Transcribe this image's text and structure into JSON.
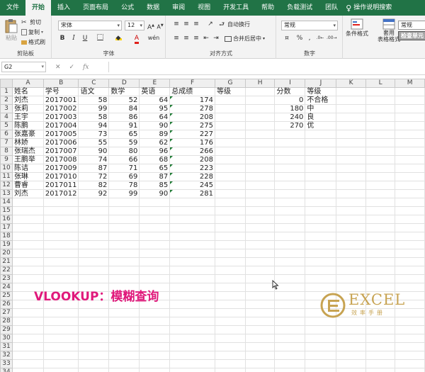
{
  "menu": {
    "tabs": [
      "文件",
      "开始",
      "插入",
      "页面布局",
      "公式",
      "数据",
      "审阅",
      "视图",
      "开发工具",
      "帮助",
      "负载测试",
      "团队"
    ],
    "active_tab": "开始",
    "tell_me": "操作说明搜索"
  },
  "ribbon": {
    "clipboard": {
      "paste": "粘贴",
      "cut": "剪切",
      "copy": "复制",
      "format_painter": "格式刷",
      "label": "剪贴板"
    },
    "font": {
      "name": "宋体",
      "size": "12",
      "bold": "B",
      "italic": "I",
      "underline": "U",
      "grow": "A",
      "shrink": "A",
      "label": "字体",
      "wen": "wén"
    },
    "alignment": {
      "wrap": "自动换行",
      "merge": "合并后居中",
      "label": "对齐方式"
    },
    "number": {
      "format": "常规",
      "percent": "%",
      "comma": ",",
      "label": "数字"
    },
    "styles": {
      "conditional": "条件格式",
      "table_format_1": "套用",
      "table_format_2": "表格格式",
      "style_1": "常规",
      "style_2": "检查单元"
    }
  },
  "formula_bar": {
    "name_box": "G2",
    "cancel": "✕",
    "enter": "✓",
    "fx": "fx",
    "value": ""
  },
  "sheet": {
    "columns": [
      "A",
      "B",
      "C",
      "D",
      "E",
      "F",
      "G",
      "H",
      "I",
      "J",
      "K",
      "L",
      "M"
    ],
    "row_numbers": [
      "1",
      "2",
      "3",
      "4",
      "5",
      "6",
      "7",
      "8",
      "9",
      "10",
      "11",
      "12",
      "13",
      "14",
      "15",
      "16",
      "17",
      "18",
      "19",
      "20",
      "21",
      "22",
      "23",
      "24",
      "25",
      "26",
      "27",
      "28",
      "29",
      "30",
      "31",
      "32",
      "33",
      "34"
    ],
    "headers": [
      "姓名",
      "学号",
      "语文",
      "数学",
      "英语",
      "总成绩",
      "等级"
    ],
    "rows": [
      [
        "刘杰",
        "2017001",
        "58",
        "52",
        "64",
        "174"
      ],
      [
        "张莉",
        "2017002",
        "99",
        "84",
        "95",
        "278"
      ],
      [
        "王宇",
        "2017003",
        "58",
        "86",
        "64",
        "208"
      ],
      [
        "陈鹏",
        "2017004",
        "94",
        "91",
        "90",
        "275"
      ],
      [
        "张嘉豪",
        "2017005",
        "73",
        "65",
        "89",
        "227"
      ],
      [
        "林娇",
        "2017006",
        "55",
        "59",
        "62",
        "176"
      ],
      [
        "张瑞杰",
        "2017007",
        "90",
        "80",
        "96",
        "266"
      ],
      [
        "王鹏举",
        "2017008",
        "74",
        "66",
        "68",
        "208"
      ],
      [
        "陈诘",
        "2017009",
        "87",
        "71",
        "65",
        "223"
      ],
      [
        "张琳",
        "2017010",
        "72",
        "69",
        "87",
        "228"
      ],
      [
        "曹睿",
        "2017011",
        "82",
        "78",
        "85",
        "245"
      ],
      [
        "刘杰",
        "2017012",
        "92",
        "99",
        "90",
        "281"
      ]
    ],
    "lookup_headers": [
      "分数",
      "等级"
    ],
    "lookup_rows": [
      [
        "0",
        "不合格"
      ],
      [
        "180",
        "中"
      ],
      [
        "240",
        "良"
      ],
      [
        "270",
        "优"
      ]
    ]
  },
  "overlay": {
    "title": "VLOOKUP：模糊查询",
    "logo_word": "EXCEL",
    "logo_sub": "效率手册"
  },
  "colors": {
    "excel_green": "#217346",
    "title_pink": "#e0197b",
    "logo_gold": "#c7a352"
  }
}
